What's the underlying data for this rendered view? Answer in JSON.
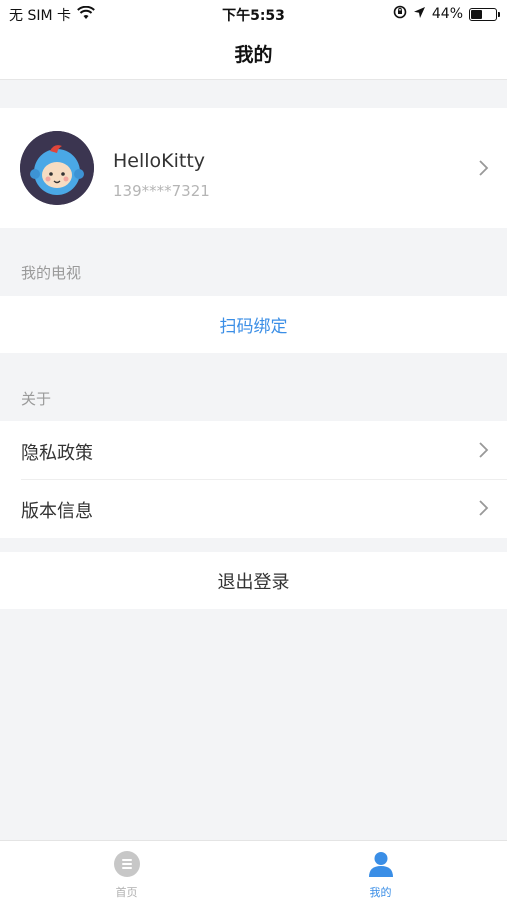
{
  "status_bar": {
    "carrier": "无 SIM 卡",
    "time": "下午5:53",
    "battery_percent": "44%",
    "battery_level": 0.44,
    "icons": [
      "wifi-icon",
      "orientation-lock-icon",
      "location-arrow-icon",
      "battery-icon"
    ]
  },
  "nav": {
    "title": "我的"
  },
  "profile": {
    "name": "HelloKitty",
    "phone": "139****7321"
  },
  "tv_section": {
    "label": "我的电视",
    "scan_bind_label": "扫码绑定"
  },
  "about_section": {
    "label": "关于",
    "items": [
      {
        "label": "隐私政策"
      },
      {
        "label": "版本信息"
      }
    ]
  },
  "logout": {
    "label": "退出登录"
  },
  "tabs": [
    {
      "label": "首页",
      "icon": "home-icon",
      "active": false
    },
    {
      "label": "我的",
      "icon": "user-icon",
      "active": true
    }
  ],
  "colors": {
    "accent": "#3a8ee6",
    "background": "#f3f4f6",
    "tab_inactive": "#b0b0b0",
    "tab_active": "#3a8ee6"
  }
}
